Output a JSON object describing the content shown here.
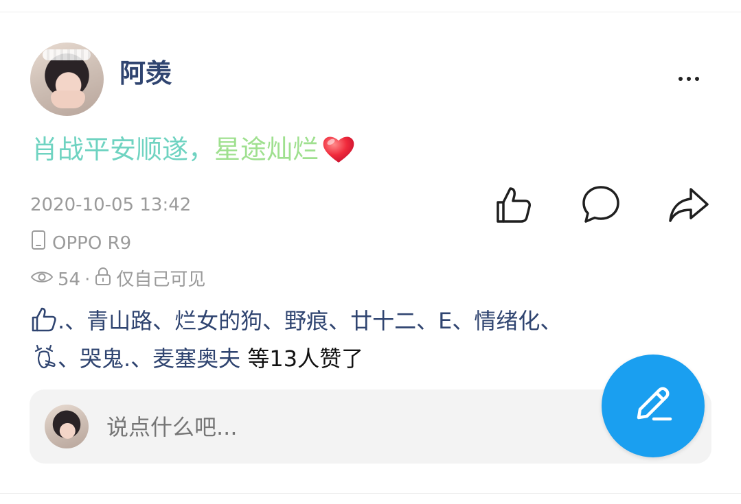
{
  "post": {
    "author": "阿羡",
    "content_part1": "肖战平安顺遂，",
    "content_part2": "星途灿烂",
    "content_emoji_icon": "red-heart-icon",
    "timestamp": "2020-10-05 13:42",
    "device": "OPPO R9",
    "views": "54",
    "views_separator": "·",
    "visibility": "仅自己可见"
  },
  "likes": {
    "line1": ".、青山路、烂女的狗、野痕、廿十二、E、情绪化、",
    "line2_names": "、哭鬼.、麦塞奥夫",
    "line2_tail": " 等13人赞了",
    "deer_icon": "deer-icon"
  },
  "comment": {
    "placeholder": "说点什么吧..."
  },
  "colors": {
    "name_blue": "#2f4470",
    "gradient_start": "#6fd3c1",
    "gradient_end": "#9fe08f",
    "meta_gray": "#9b9b9b",
    "fab_blue": "#1a9ff0"
  },
  "icons": [
    "more-icon",
    "thumbs-up-icon",
    "comment-bubble-icon",
    "share-arrow-icon",
    "phone-icon",
    "eye-icon",
    "lock-icon",
    "pencil-icon"
  ]
}
